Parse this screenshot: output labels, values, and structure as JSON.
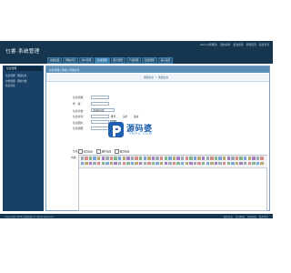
{
  "header": {
    "logo": "乜睿·系统管理",
    "top_links": [
      "admin[管理员]",
      "我的资料",
      "更改密码",
      "管理首页",
      "退出登录"
    ]
  },
  "nav": [
    "系统设置",
    "网站栏目",
    "用户管理",
    "信息管理",
    "留言管理",
    "产品管理",
    "链接管理",
    "其它设置"
  ],
  "sidebar": {
    "title": "信息管理",
    "items": [
      [
        "信息管理",
        "添加信息"
      ],
      [
        "分类管理",
        "添加分类"
      ],
      [
        "信息评论"
      ]
    ]
  },
  "main": {
    "breadcrumb": "信息管理 | 添加 | 修改信息",
    "subtabs": [
      "添加信息",
      "修改信息"
    ],
    "form": {
      "title_label": "信息标题：",
      "author_label": "作　者：",
      "category_label": "信息分类：",
      "category_value": "请选择分类",
      "date_label": "信息时间：",
      "image_label": "信息图片：",
      "image_button": "上传",
      "summary_label": "信息摘要：",
      "options": [
        "推荐",
        "头条",
        "滚动"
      ],
      "attr_label": "信息属性：",
      "attr_checks": [
        "首页显示",
        "图片新闻",
        "推荐新闻"
      ],
      "content_label": "内容："
    },
    "watermark": {
      "text": "源码婆",
      "url": "YMPO.COM"
    }
  },
  "footer": {
    "copyright": "Copyright 2009 系统管理 All rights reserved",
    "links": [
      "版本信息",
      "官方网站",
      "使用帮助",
      "联系我们"
    ]
  },
  "colors": {
    "header_bg": "#16364f",
    "sidebar_bg": "#194066",
    "breadcrumb_bg": "#5b8fb8",
    "watermark_blue": "#1f5fb0"
  }
}
